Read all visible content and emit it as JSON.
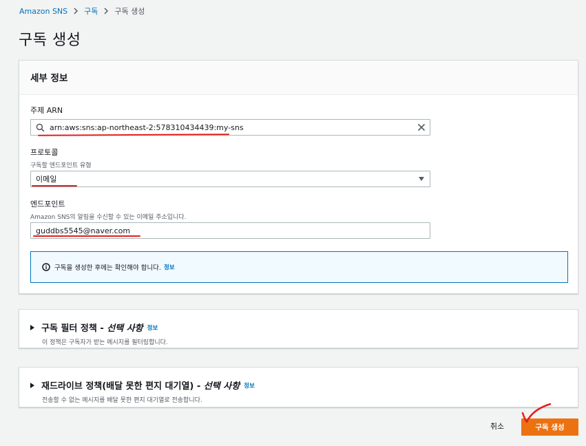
{
  "breadcrumb": {
    "items": [
      "Amazon SNS",
      "구독",
      "구독 생성"
    ]
  },
  "page": {
    "title": "구독 생성"
  },
  "details": {
    "title": "세부 정보",
    "topic_arn": {
      "label": "주제 ARN",
      "value": "arn:aws:sns:ap-northeast-2:578310434439:my-sns"
    },
    "protocol": {
      "label": "프로토콜",
      "description": "구독할 엔드포인트 유형",
      "value": "이메일"
    },
    "endpoint": {
      "label": "엔드포인트",
      "description": "Amazon SNS의 알림을 수신할 수 있는 이메일 주소입니다.",
      "value": "guddbs5545@naver.com"
    },
    "alert": {
      "text": "구독을 생성한 후에는 확인해야 합니다.",
      "link": "정보"
    }
  },
  "filter_policy": {
    "title": "구독 필터 정책 - ",
    "title_optional": "선택 사항",
    "info": "정보",
    "description": "이 정책은 구독자가 받는 메시지를 필터링합니다."
  },
  "redrive_policy": {
    "title": "재드라이브 정책(배달 못한 편지 대기열) - ",
    "title_optional": "선택 사항",
    "info": "정보",
    "description": "전송할 수 없는 메시지를 배달 못한 편지 대기열로 전송합니다."
  },
  "actions": {
    "cancel": "취소",
    "create": "구독 생성"
  },
  "colors": {
    "link": "#0073bb",
    "primary": "#ec7211",
    "annotation": "#e41c1c"
  }
}
